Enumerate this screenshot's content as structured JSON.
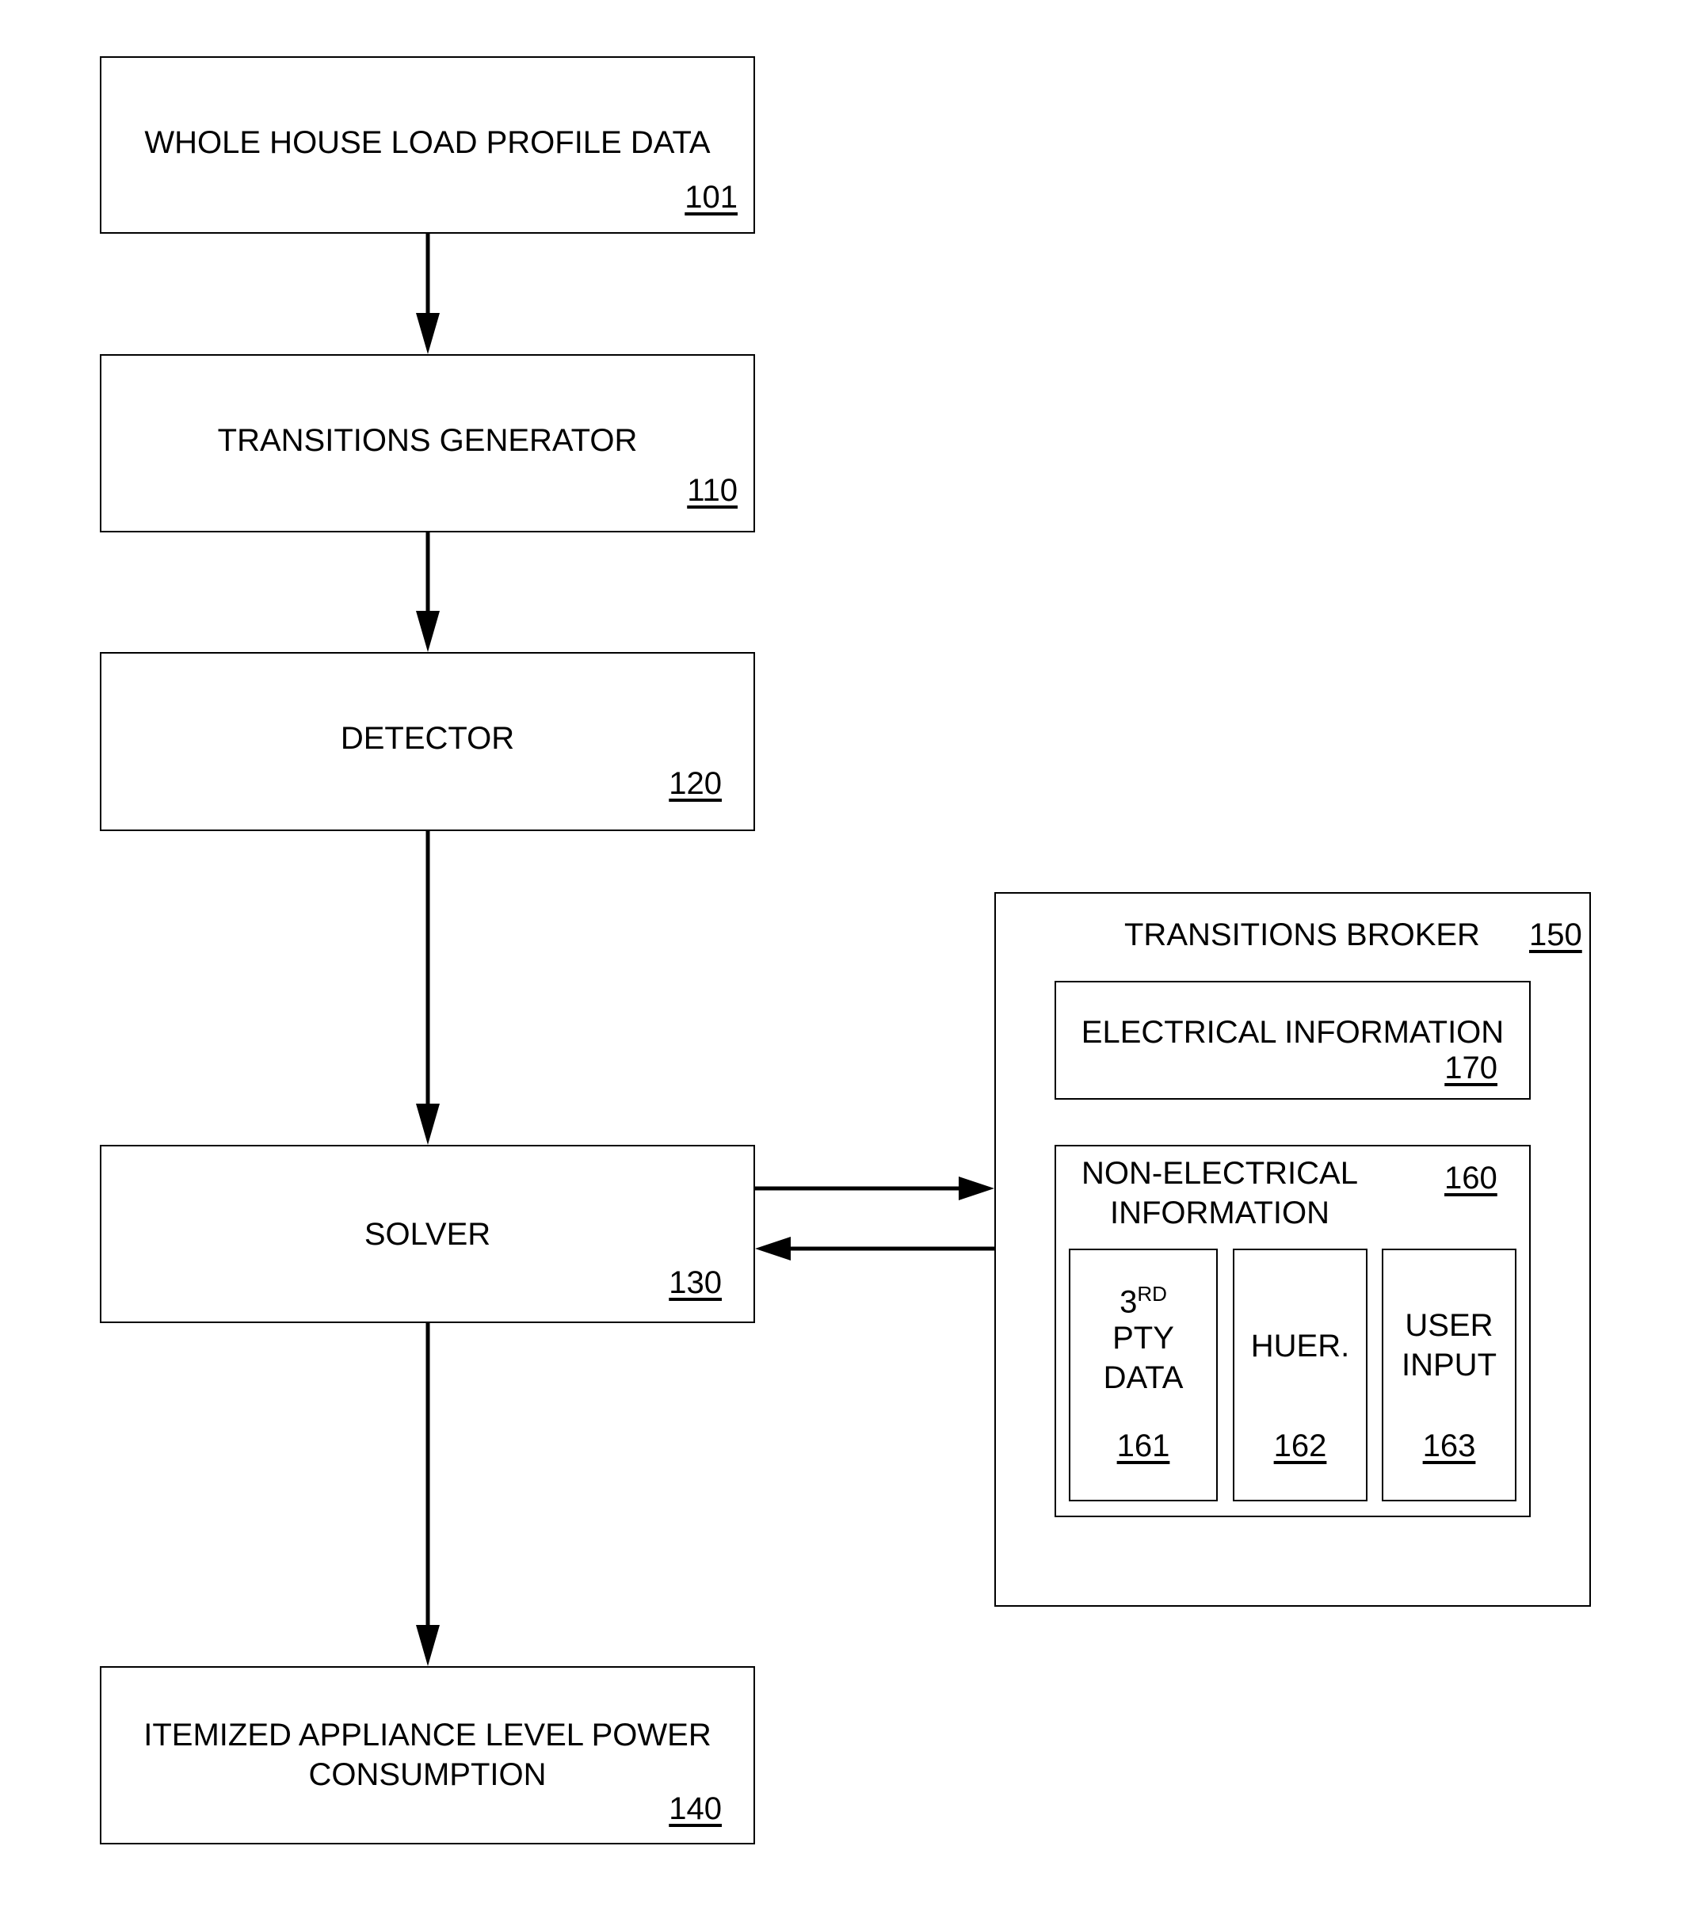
{
  "blocks": {
    "whole_house": {
      "label": "WHOLE HOUSE LOAD PROFILE DATA",
      "ref": "101"
    },
    "transitions_generator": {
      "label": "TRANSITIONS GENERATOR",
      "ref": "110"
    },
    "detector": {
      "label": "DETECTOR",
      "ref": "120"
    },
    "solver": {
      "label": "SOLVER",
      "ref": "130"
    },
    "itemized": {
      "label_line1": "ITEMIZED APPLIANCE LEVEL POWER",
      "label_line2": "CONSUMPTION",
      "ref": "140"
    },
    "transitions_broker": {
      "label": "TRANSITIONS BROKER",
      "ref": "150"
    },
    "electrical_info": {
      "label": "ELECTRICAL INFORMATION",
      "ref": "170"
    },
    "non_electrical_info": {
      "label_line1": "NON-ELECTRICAL",
      "label_line2": "INFORMATION",
      "ref": "160"
    },
    "third_party": {
      "label_num": "3",
      "label_sup": "RD",
      "label_line2": "PTY",
      "label_line3": "DATA",
      "ref": "161"
    },
    "heuristics": {
      "label": "HUER.",
      "ref": "162"
    },
    "user_input": {
      "label_line1": "USER",
      "label_line2": "INPUT",
      "ref": "163"
    }
  },
  "connections": [
    {
      "from": "101",
      "to": "110"
    },
    {
      "from": "110",
      "to": "120"
    },
    {
      "from": "120",
      "to": "130"
    },
    {
      "from": "130",
      "to": "150"
    },
    {
      "from": "150",
      "to": "130"
    },
    {
      "from": "130",
      "to": "140"
    }
  ]
}
